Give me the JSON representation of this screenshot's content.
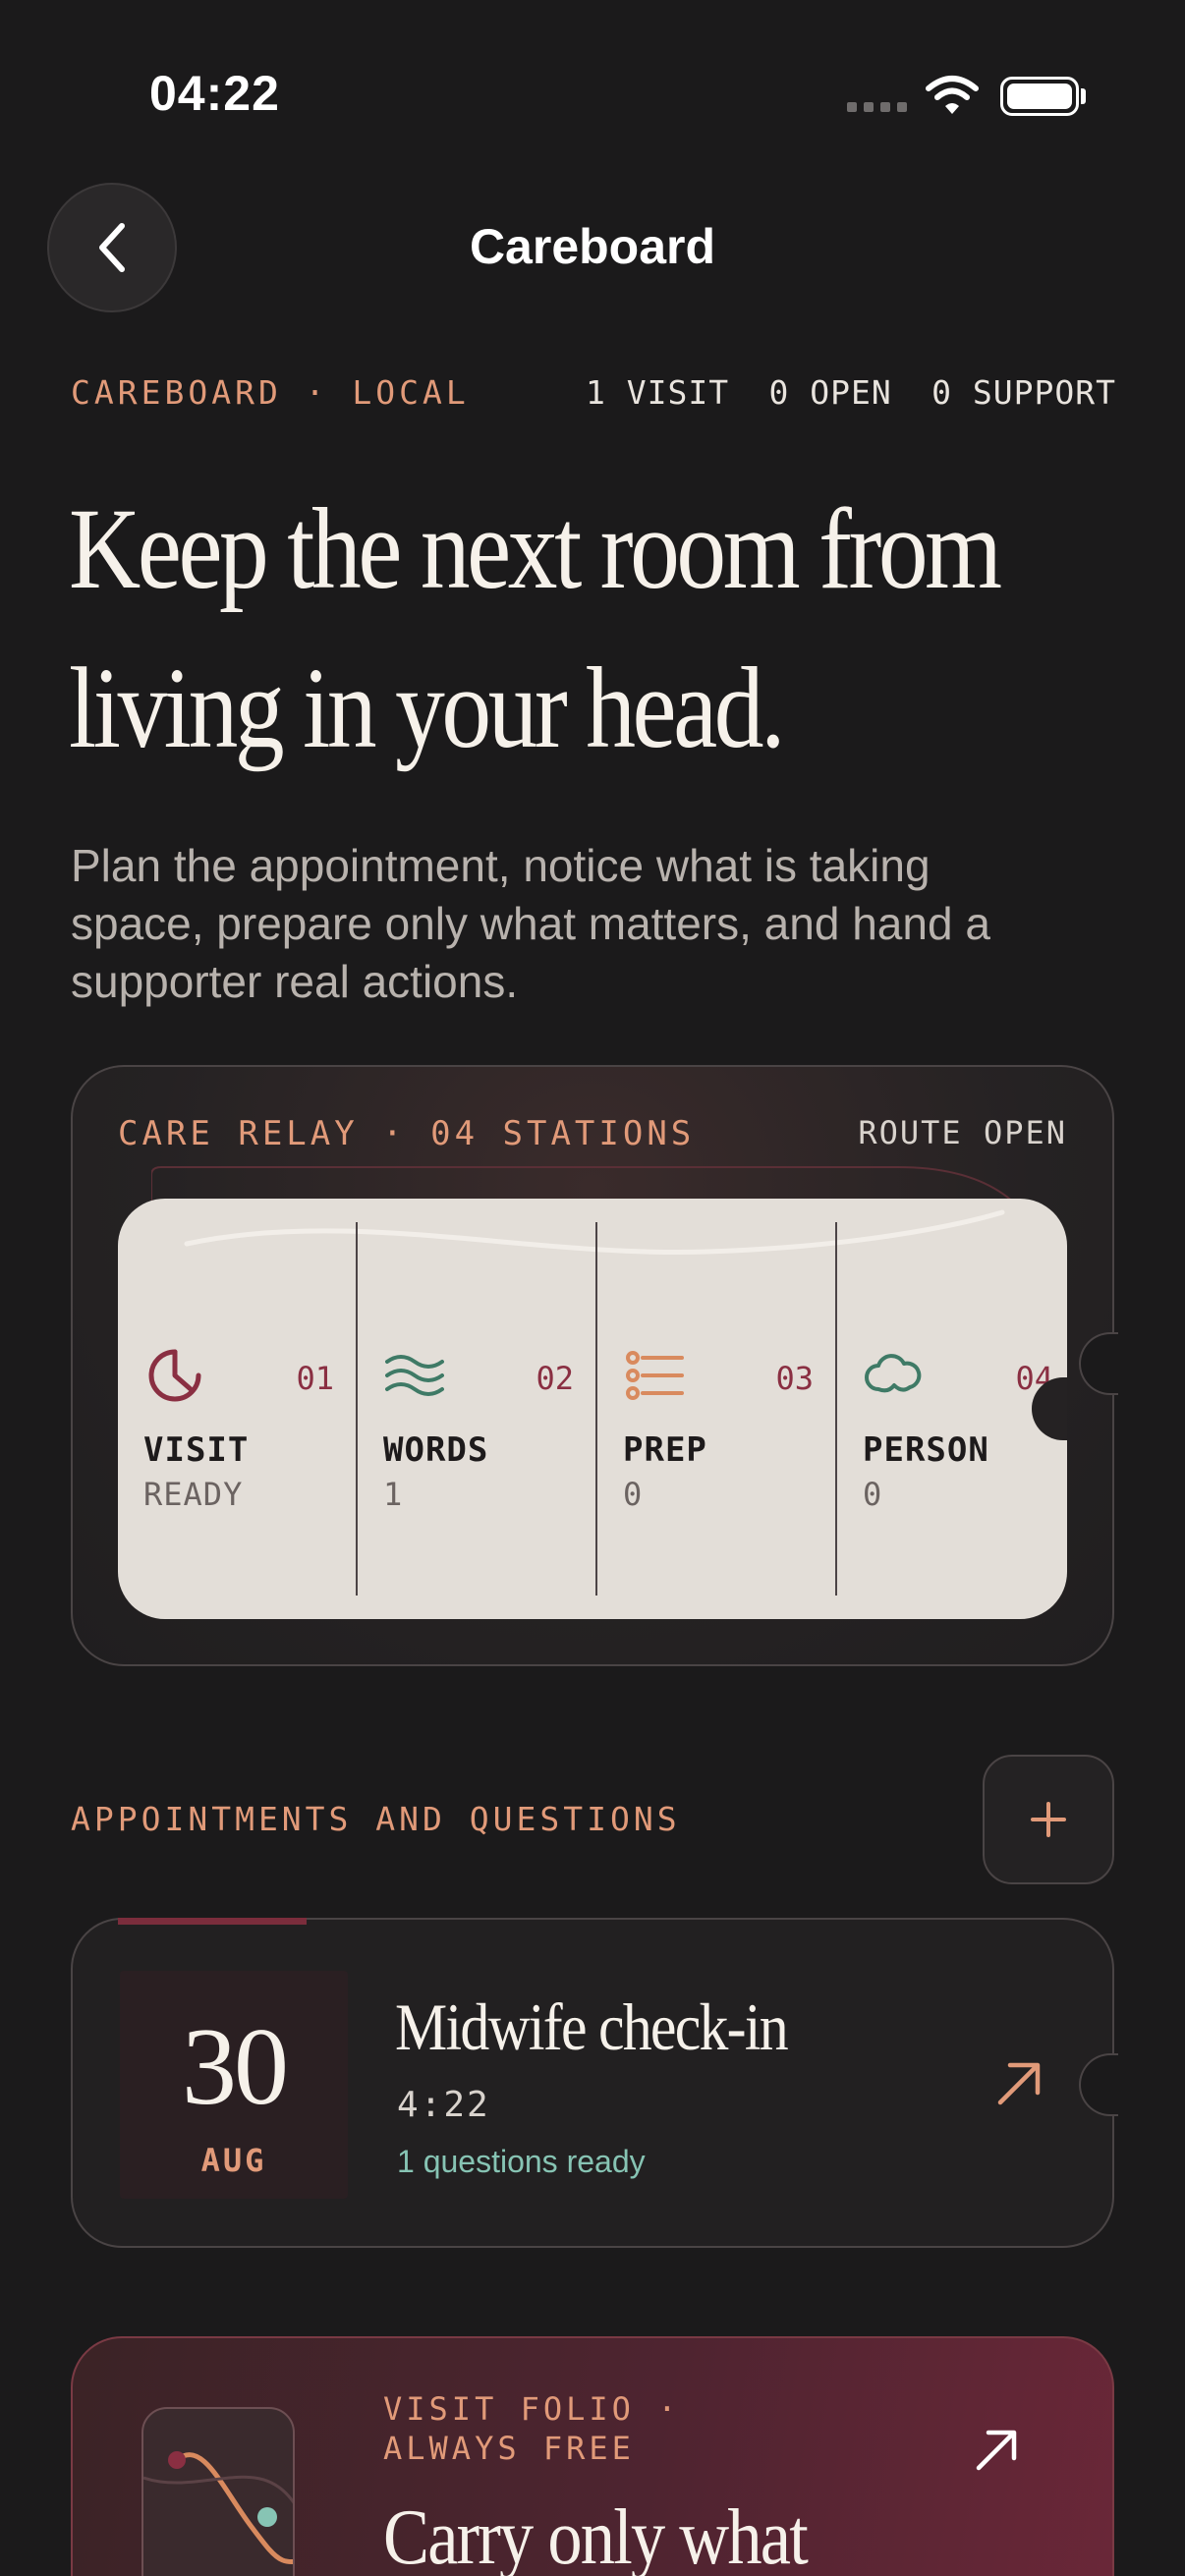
{
  "status_bar": {
    "time": "04:22"
  },
  "nav": {
    "title": "Careboard"
  },
  "meta": {
    "brand": "CAREBOARD · LOCAL",
    "stats": [
      "1 VISIT",
      "0 OPEN",
      "0 SUPPORT"
    ]
  },
  "headline": {
    "line1": "Keep the next room from",
    "line2": "living in your head."
  },
  "subtext": "Plan the appointment, notice what is taking space, prepare only what matters, and hand a supporter real actions.",
  "relay": {
    "label": "CARE RELAY · 04 STATIONS",
    "status": "ROUTE OPEN",
    "stations": [
      {
        "num": "01",
        "name": "VISIT",
        "value": "READY",
        "icon": "clock-pie-icon",
        "color": "#8a2f42"
      },
      {
        "num": "02",
        "name": "WORDS",
        "value": "1",
        "icon": "waves-icon",
        "color": "#3f7a66"
      },
      {
        "num": "03",
        "name": "PREP",
        "value": "0",
        "icon": "checklist-icon",
        "color": "#d98a5e"
      },
      {
        "num": "04",
        "name": "PERSON",
        "value": "0",
        "icon": "cloud-person-icon",
        "color": "#3f7a66"
      }
    ]
  },
  "appointments": {
    "label": "APPOINTMENTS AND QUESTIONS",
    "items": [
      {
        "day": "30",
        "month": "AUG",
        "title": "Midwife check-in",
        "time": "4:22",
        "questions": "1 questions ready"
      }
    ]
  },
  "folio": {
    "label": "VISIT FOLIO · ALWAYS FREE",
    "title": "Carry only what"
  },
  "colors": {
    "background": "#1b1a1b",
    "accent": "#e19a79",
    "wine": "#8a2f42",
    "sage": "#87c4b4"
  }
}
